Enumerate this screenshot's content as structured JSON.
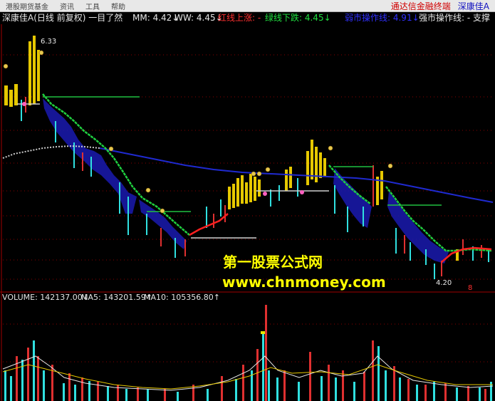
{
  "menu": {
    "items": [
      "港股期货基金",
      "资讯",
      "工具",
      "帮助"
    ],
    "promo": "通达信金融终端",
    "current_stock": "深康佳A"
  },
  "indicator_header": {
    "name": "深康佳A(日线 前复权) 一目了然",
    "mm": "MM: 4.42↓",
    "ww": "WW: 4.45↓",
    "red_up": "红线上涨: -",
    "green_down": "绿线下跌: 4.45↓",
    "weak_line": "弱市操作线: 4.91↓",
    "strong_line": "强市操作线: - 支撑"
  },
  "volume_header": {
    "volume": "VOLUME: 142137.00↓",
    "ma5": "MA5: 143201.59↑",
    "ma10": "MA10: 105356.80↑"
  },
  "annotations": {
    "high": "6.33",
    "low": "4.20",
    "marker": "8"
  },
  "watermark": {
    "site_name_cn": "第一股票公式网",
    "site_url": "www.chnmoney.com"
  },
  "chart_data": {
    "type": "line",
    "title": "深康佳A(日线 前复权) 一目了然",
    "price_high": 6.33,
    "price_low": 4.2,
    "close_series_normalized": [
      0.72,
      0.74,
      0.78,
      0.96,
      1.0,
      0.82,
      0.7,
      0.64,
      0.6,
      0.56,
      0.52,
      0.48,
      0.42,
      0.38,
      0.4,
      0.36,
      0.3,
      0.26,
      0.22,
      0.18,
      0.2,
      0.24,
      0.22,
      0.18,
      0.14,
      0.1,
      0.12,
      0.16,
      0.2,
      0.24,
      0.26,
      0.3,
      0.34,
      0.36,
      0.38,
      0.4,
      0.42,
      0.44,
      0.4,
      0.42,
      0.46,
      0.48,
      0.52,
      0.5,
      0.46,
      0.44,
      0.48,
      0.52,
      0.5,
      0.44,
      0.38,
      0.34,
      0.3,
      0.26,
      0.28,
      0.32,
      0.36,
      0.4,
      0.34,
      0.28,
      0.24,
      0.2,
      0.16,
      0.12,
      0.08,
      0.04,
      0.06,
      0.08,
      0.07,
      0.06
    ]
  }
}
